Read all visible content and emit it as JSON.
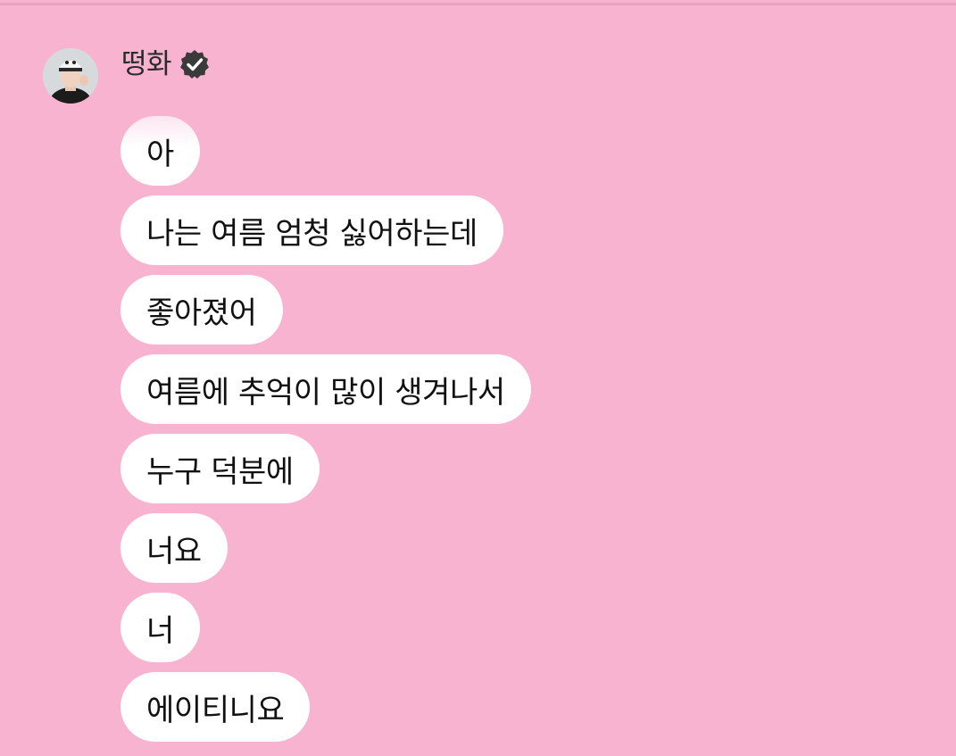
{
  "chat": {
    "sender": {
      "name": "떵화",
      "verified": true,
      "avatar_icon": "profile-photo"
    },
    "colors": {
      "background": "#f7b3cf",
      "bubble": "#ffffff",
      "text": "#111111",
      "badge": "#3a3a3a"
    },
    "messages": [
      {
        "text": "아"
      },
      {
        "text": "나는 여름 엄청 싫어하는데"
      },
      {
        "text": "좋아졌어"
      },
      {
        "text": "여름에 추억이 많이 생겨나서"
      },
      {
        "text": "누구 덕분에"
      },
      {
        "text": "너요"
      },
      {
        "text": "너"
      },
      {
        "text": "에이티니요"
      }
    ]
  }
}
